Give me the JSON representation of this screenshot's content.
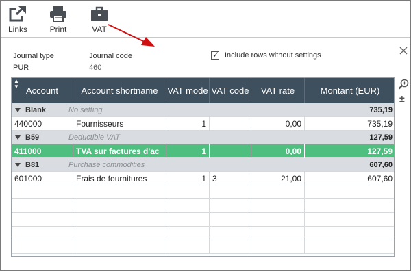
{
  "toolbar": {
    "links_label": "Links",
    "print_label": "Print",
    "vat_label": "VAT"
  },
  "header": {
    "journal_type_label": "Journal type",
    "journal_type_value": "PUR",
    "journal_code_label": "Journal code",
    "journal_code_value": "460",
    "include_rows_label": "Include rows without settings",
    "include_rows_checked": true
  },
  "grid": {
    "columns": [
      "Account",
      "Account shortname",
      "VAT mode",
      "VAT code",
      "VAT rate",
      "Montant (EUR)"
    ],
    "groups": [
      {
        "name": "Blank",
        "description": "No setting",
        "total": "735,19",
        "rows": [
          {
            "account": "440000",
            "shortname": "Fournisseurs",
            "vat_mode": "1",
            "vat_code": "",
            "vat_rate": "0,00",
            "amount": "735,19",
            "selected": false
          }
        ]
      },
      {
        "name": "B59",
        "description": "Deductible VAT",
        "total": "127,59",
        "rows": [
          {
            "account": "411000",
            "shortname": "TVA sur factures d'ac",
            "vat_mode": "1",
            "vat_code": "",
            "vat_rate": "0,00",
            "amount": "127,59",
            "selected": true
          }
        ]
      },
      {
        "name": "B81",
        "description": "Purchase commodities",
        "total": "607,60",
        "rows": [
          {
            "account": "601000",
            "shortname": "Frais de fournitures",
            "vat_mode": "1",
            "vat_code": "3",
            "vat_rate": "21,00",
            "amount": "607,60",
            "selected": false
          }
        ]
      }
    ]
  },
  "colors": {
    "header_bg": "#3e4f5d",
    "group_bg": "#d9dde1",
    "selected_bg": "#4fbf80",
    "annotation": "#d01010"
  }
}
